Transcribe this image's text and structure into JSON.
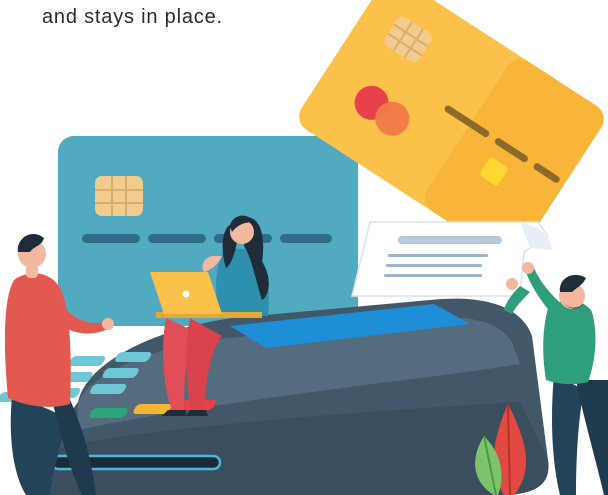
{
  "caption": {
    "text": "and stays in place."
  },
  "illustration": {
    "subject": "payment-terminal-with-credit-cards-and-people",
    "colors": {
      "blue_card": "#4EA7BC",
      "yellow_card": "#FBC14A",
      "terminal_body": "#425767",
      "terminal_screen": "#1E8FD6",
      "red_accent": "#E8414C",
      "orange_accent": "#F07A48",
      "chip": "#F2CC8F",
      "shirt_red": "#E25A4F",
      "shirt_green": "#2E9E7D",
      "pants_red": "#E24E57",
      "pants_dark": "#234458"
    }
  }
}
